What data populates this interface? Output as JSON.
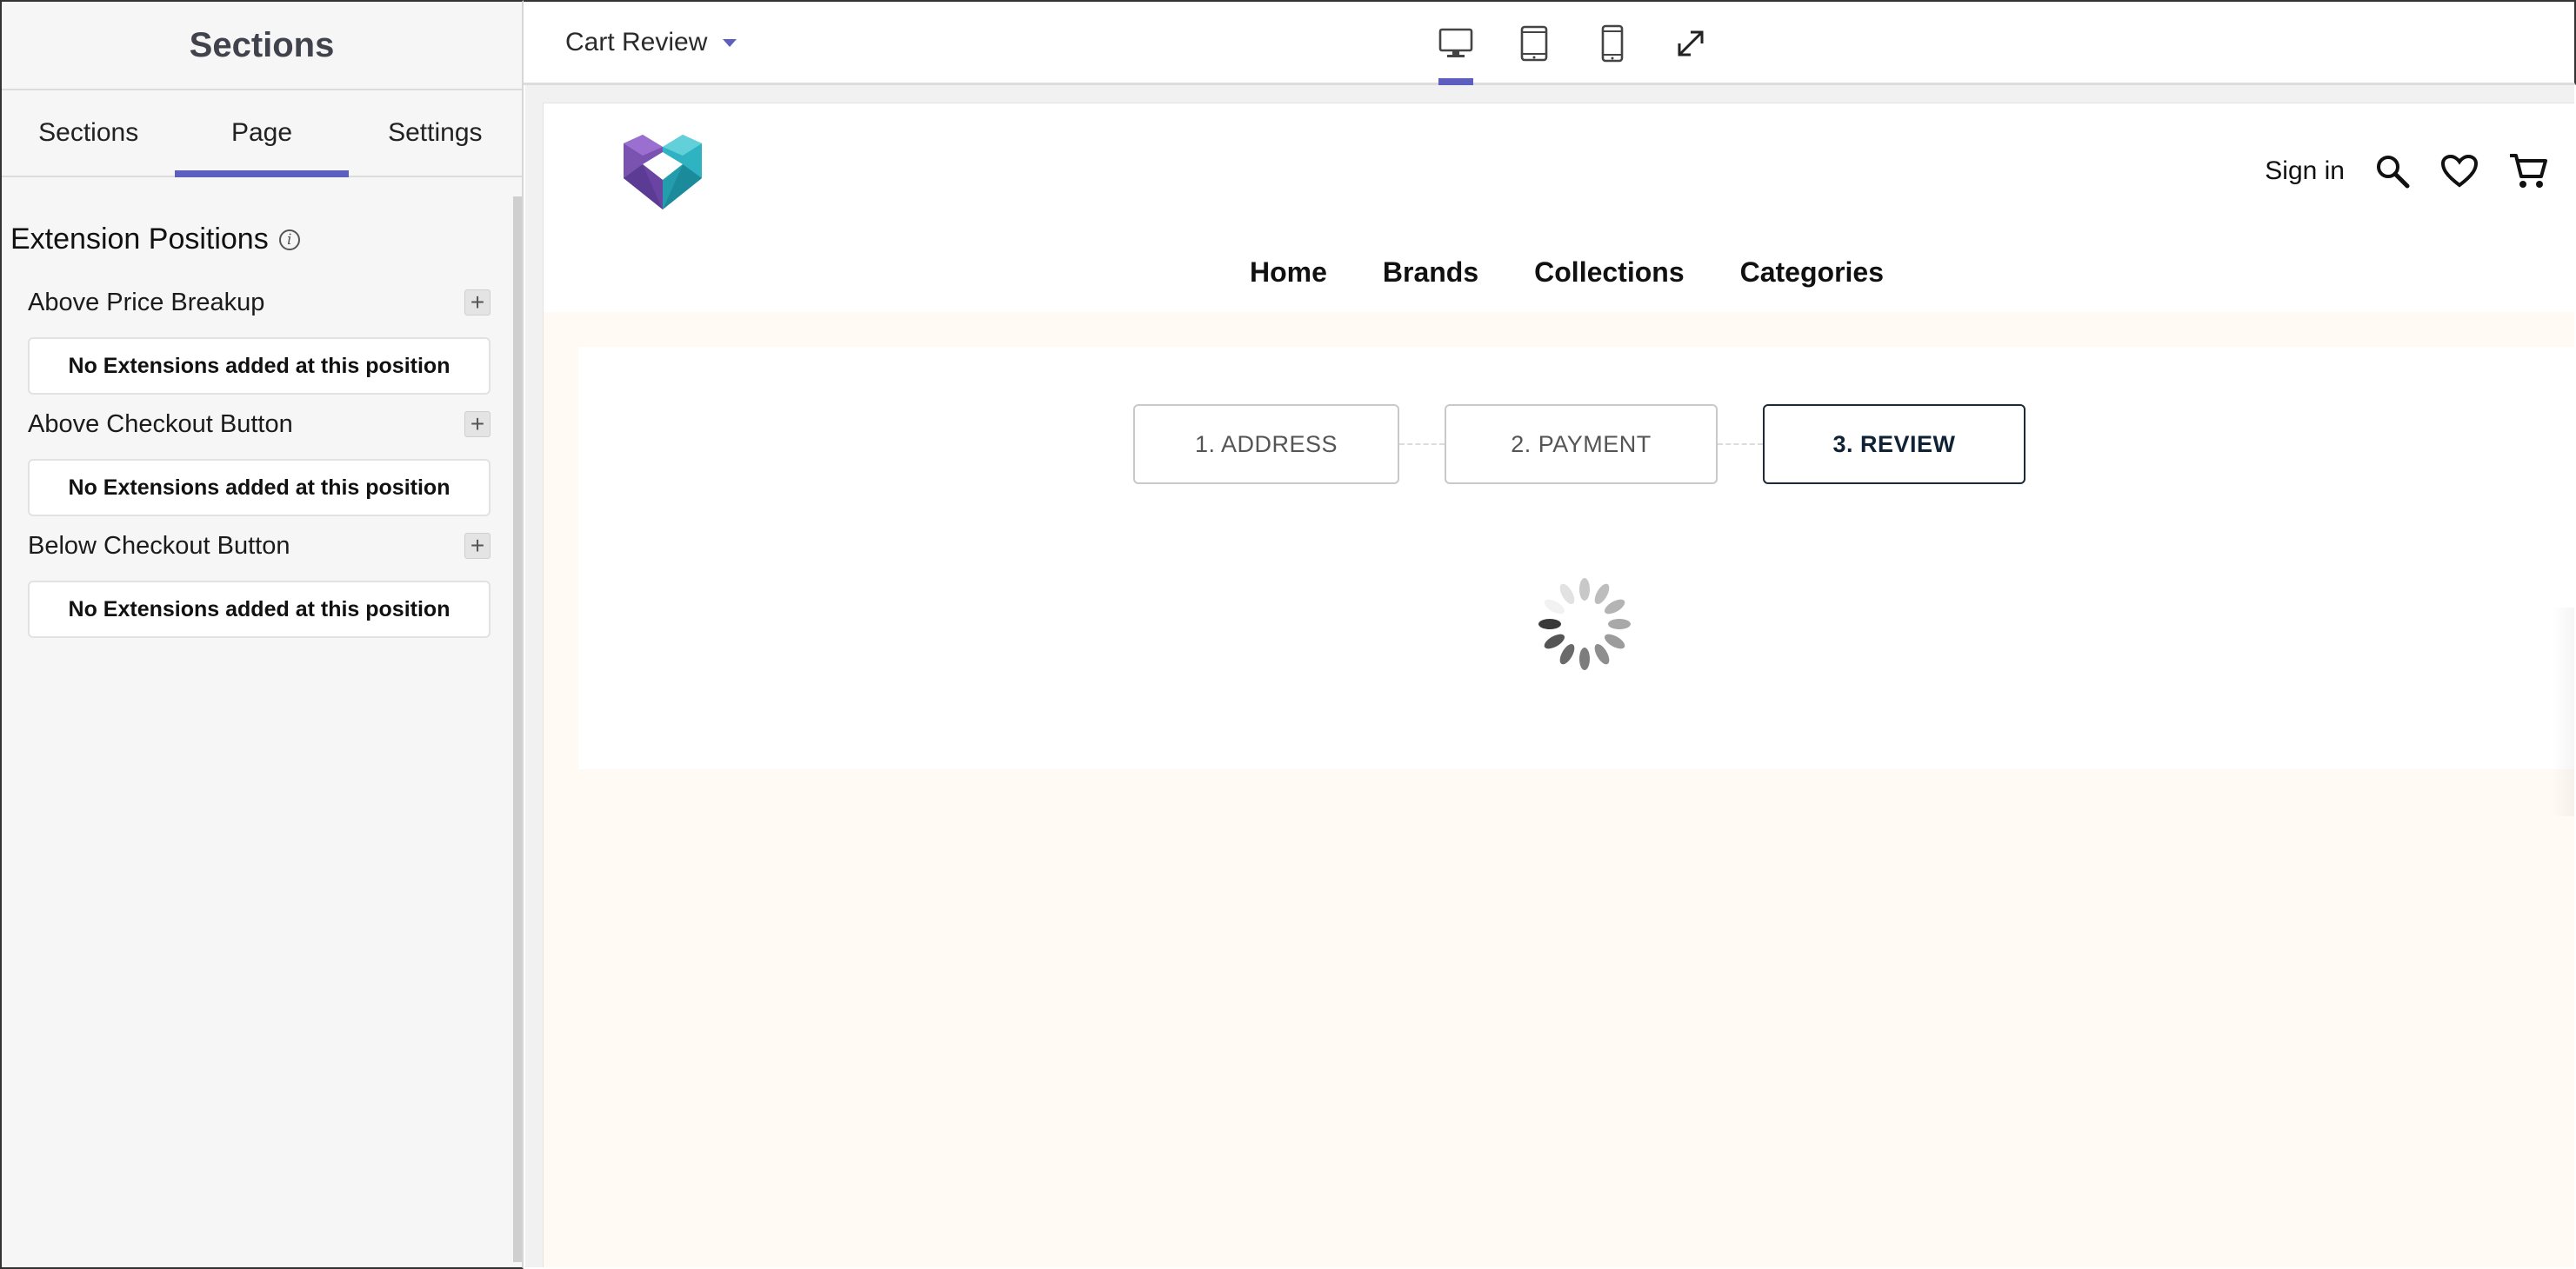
{
  "left_panel": {
    "title": "Sections",
    "tabs": [
      {
        "label": "Sections",
        "active": false
      },
      {
        "label": "Page",
        "active": true
      },
      {
        "label": "Settings",
        "active": false
      }
    ],
    "extension_title": "Extension Positions",
    "info_icon": "info-icon",
    "positions": [
      {
        "label": "Above Price Breakup",
        "empty_text": "No Extensions added at this position"
      },
      {
        "label": "Above Checkout Button",
        "empty_text": "No Extensions added at this position"
      },
      {
        "label": "Below Checkout Button",
        "empty_text": "No Extensions added at this position"
      }
    ]
  },
  "topbar": {
    "page_name": "Cart Review",
    "devices": [
      {
        "icon": "desktop-icon",
        "active": true
      },
      {
        "icon": "tablet-icon",
        "active": false
      },
      {
        "icon": "mobile-icon",
        "active": false
      },
      {
        "icon": "fullscreen-icon",
        "active": false
      }
    ]
  },
  "preview": {
    "header": {
      "signin": "Sign in",
      "icons": [
        "search-icon",
        "heart-icon",
        "cart-icon"
      ]
    },
    "nav": [
      "Home",
      "Brands",
      "Collections",
      "Categories"
    ],
    "steps": [
      {
        "label": "1. ADDRESS",
        "active": false
      },
      {
        "label": "2. PAYMENT",
        "active": false
      },
      {
        "label": "3. REVIEW",
        "active": true
      }
    ]
  },
  "colors": {
    "accent": "#5c5fc0",
    "preview_bg": "#fffaf4",
    "step_active_border": "#1c2a3a"
  }
}
